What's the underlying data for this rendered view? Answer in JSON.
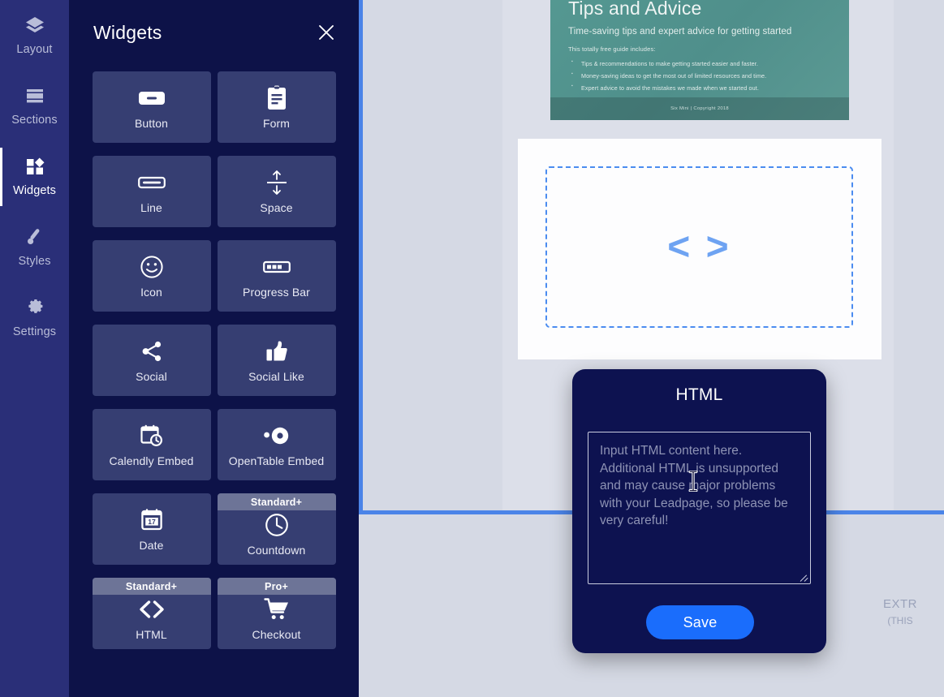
{
  "rail": {
    "items": [
      {
        "label": "Layout",
        "icon": "layers-icon",
        "active": false
      },
      {
        "label": "Sections",
        "icon": "sections-icon",
        "active": false
      },
      {
        "label": "Widgets",
        "icon": "widgets-icon",
        "active": true
      },
      {
        "label": "Styles",
        "icon": "brush-icon",
        "active": false
      },
      {
        "label": "Settings",
        "icon": "gear-icon",
        "active": false
      }
    ]
  },
  "panel": {
    "title": "Widgets",
    "close_icon": "close-icon",
    "widgets": [
      {
        "label": "Button",
        "icon": "button-icon",
        "badge": ""
      },
      {
        "label": "Form",
        "icon": "form-icon",
        "badge": ""
      },
      {
        "label": "Line",
        "icon": "line-icon",
        "badge": ""
      },
      {
        "label": "Space",
        "icon": "space-icon",
        "badge": ""
      },
      {
        "label": "Icon",
        "icon": "smiley-icon",
        "badge": ""
      },
      {
        "label": "Progress Bar",
        "icon": "progress-bar-icon",
        "badge": ""
      },
      {
        "label": "Social",
        "icon": "share-icon",
        "badge": ""
      },
      {
        "label": "Social Like",
        "icon": "thumbs-up-icon",
        "badge": ""
      },
      {
        "label": "Calendly Embed",
        "icon": "calendar-clock-icon",
        "badge": ""
      },
      {
        "label": "OpenTable Embed",
        "icon": "opentable-icon",
        "badge": ""
      },
      {
        "label": "Date",
        "icon": "calendar-17-icon",
        "badge": ""
      },
      {
        "label": "Countdown",
        "icon": "clock-icon",
        "badge": "Standard+"
      },
      {
        "label": "HTML",
        "icon": "code-icon",
        "badge": "Standard+"
      },
      {
        "label": "Checkout",
        "icon": "shopping-cart-icon",
        "badge": "Pro+"
      }
    ]
  },
  "modal": {
    "title": "HTML",
    "textarea_placeholder": "Input HTML content here. Additional HTML is unsupported and may cause major problems with your Leadpage, so please be very careful!",
    "textarea_value": "",
    "save_label": "Save"
  },
  "canvas": {
    "promo": {
      "title": "Tips and Advice",
      "subtitle": "Time-saving tips and expert advice for getting started",
      "lead": "This totally free guide includes:",
      "bullets": [
        "Tips & recommendations to make getting started easier and faster.",
        "Money-saving ideas to get the most out of limited resources and time.",
        "Expert advice to avoid the mistakes we made when we started out."
      ],
      "footer": "Six Mini | Copyright 2018"
    },
    "html_placeholder": {
      "glyph": "< >",
      "icon": "code-icon"
    },
    "extra": {
      "line1": "EXTR",
      "line2": "(THIS"
    }
  },
  "colors": {
    "rail_bg": "#2a2f78",
    "panel_bg": "#0d1248",
    "tile_bg": "#363e72",
    "badge_bg": "#6d7497",
    "modal_bg": "#0d1250",
    "accent_blue": "#1a6dfc",
    "selection_blue": "#4b84e8",
    "promo_teal": "#569a93",
    "canvas_bg": "#d5d9e4"
  }
}
